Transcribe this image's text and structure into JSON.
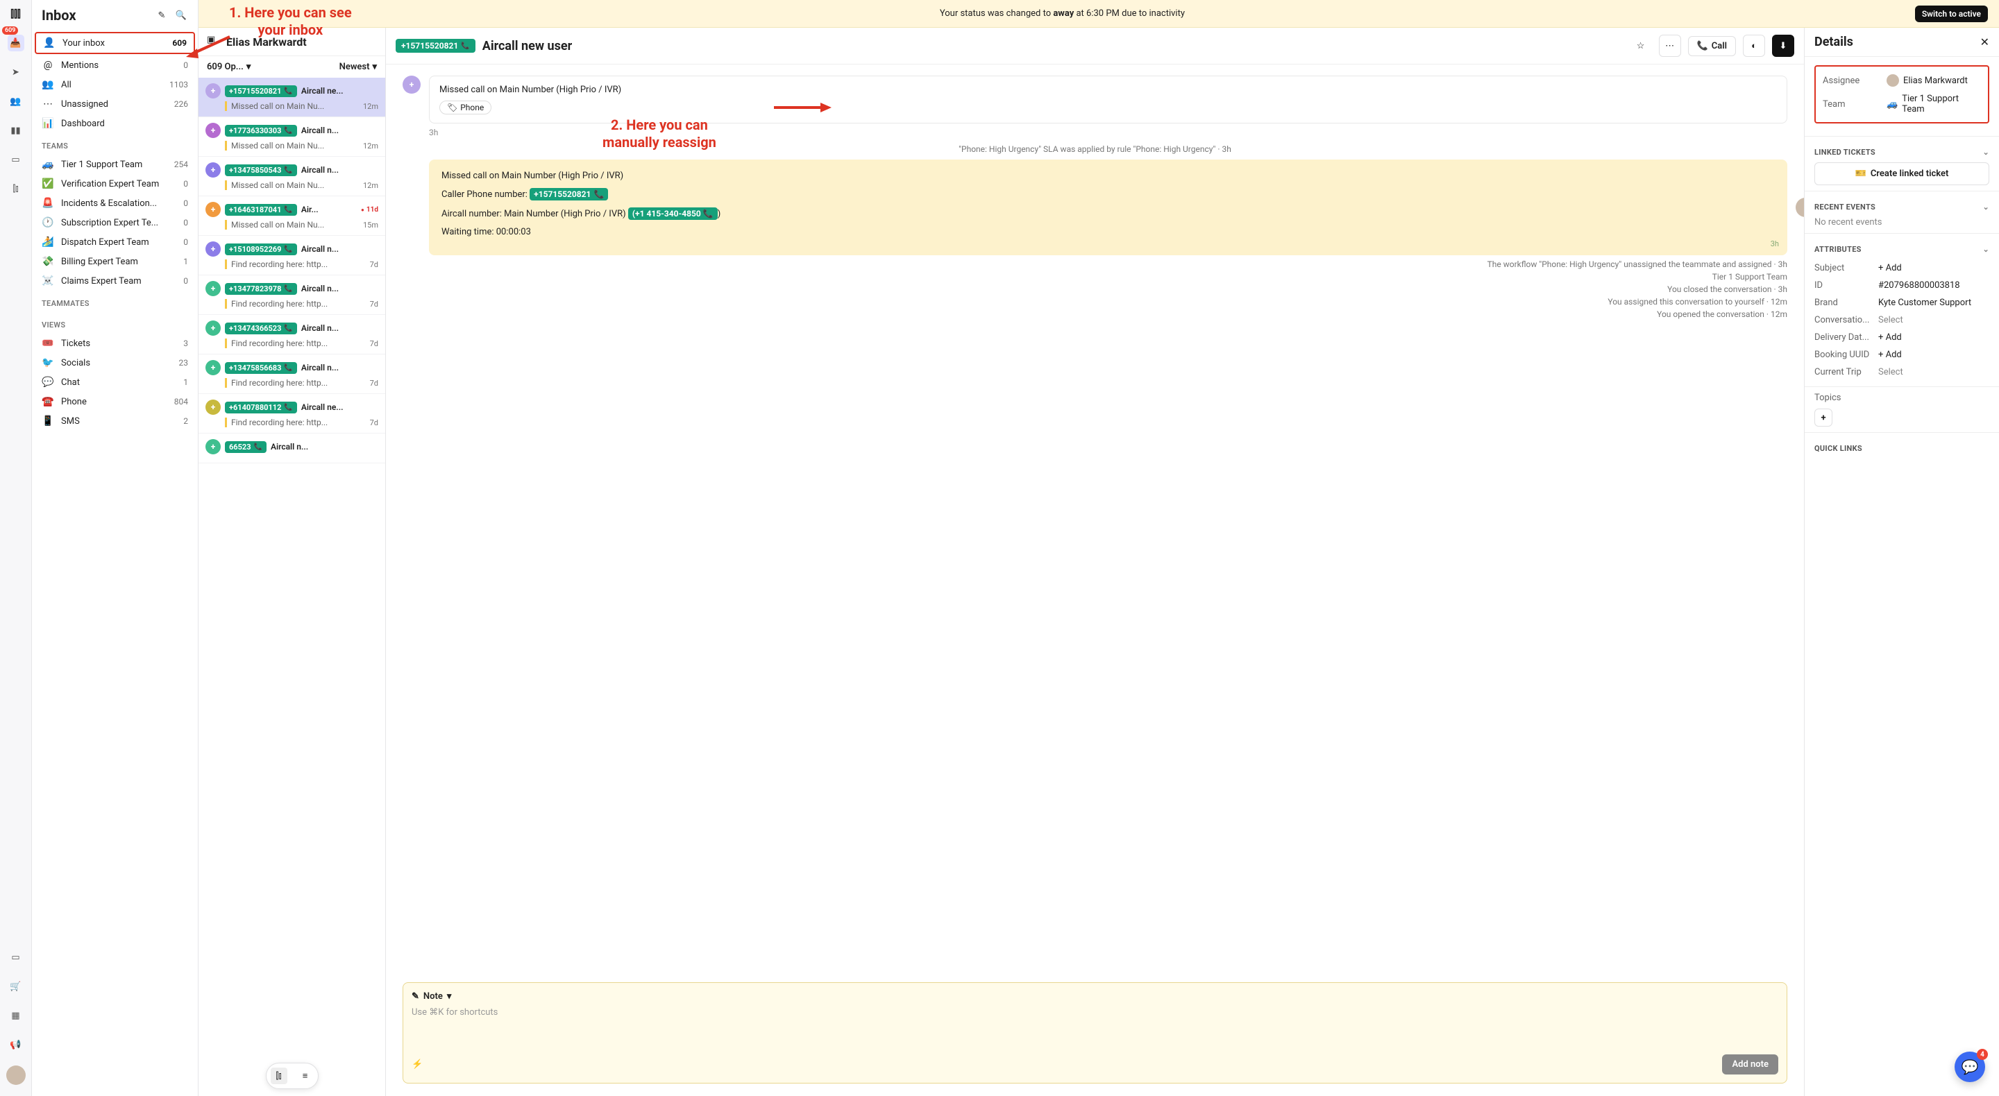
{
  "banner": {
    "text_prefix": "Your status was changed to ",
    "status_word": "away",
    "text_mid": " at 6:30 PM due to inactivity",
    "button": "Switch to active"
  },
  "rail": {
    "badge": "609"
  },
  "sidebar": {
    "title": "Inbox",
    "main": [
      {
        "icon": "👤",
        "label": "Your inbox",
        "count": "609",
        "boxed": true
      },
      {
        "icon": "@",
        "label": "Mentions",
        "count": "0"
      },
      {
        "icon": "👥",
        "label": "All",
        "count": "1103"
      },
      {
        "icon": "⋯",
        "label": "Unassigned",
        "count": "226"
      },
      {
        "icon": "📊",
        "label": "Dashboard",
        "count": ""
      }
    ],
    "teams_header": "TEAMS",
    "teams": [
      {
        "icon": "🚙",
        "label": "Tier 1 Support Team",
        "count": "254"
      },
      {
        "icon": "✅",
        "label": "Verification Expert Team",
        "count": "0"
      },
      {
        "icon": "🚨",
        "label": "Incidents & Escalation...",
        "count": "0"
      },
      {
        "icon": "🕐",
        "label": "Subscription Expert Te...",
        "count": "0"
      },
      {
        "icon": "🏄",
        "label": "Dispatch Expert Team",
        "count": "0"
      },
      {
        "icon": "💸",
        "label": "Billing Expert Team",
        "count": "1"
      },
      {
        "icon": "☠️",
        "label": "Claims Expert Team",
        "count": "0"
      }
    ],
    "teammates_header": "TEAMMATES",
    "views_header": "VIEWS",
    "views": [
      {
        "icon": "🎟️",
        "label": "Tickets",
        "count": "3"
      },
      {
        "icon": "🐦",
        "label": "Socials",
        "count": "23"
      },
      {
        "icon": "💬",
        "label": "Chat",
        "count": "1"
      },
      {
        "icon": "☎️",
        "label": "Phone",
        "count": "804"
      },
      {
        "icon": "📱",
        "label": "SMS",
        "count": "2"
      }
    ]
  },
  "convlist": {
    "header": "Elias Markwardt",
    "open_count": "609 Op...",
    "sort": "Newest",
    "items": [
      {
        "color": "#b9a6e8",
        "avatar": "+",
        "phone": "+15715520821",
        "subj": "Aircall ne...",
        "preview": "Missed call on Main Nu...",
        "time": "12m",
        "selected": true
      },
      {
        "color": "#b56bd0",
        "avatar": "+",
        "phone": "+17736330303",
        "subj": "Aircall n...",
        "preview": "Missed call on Main Nu...",
        "time": "12m"
      },
      {
        "color": "#8c7de8",
        "avatar": "+",
        "phone": "+13475850543",
        "subj": "Aircall n...",
        "preview": "Missed call on Main Nu...",
        "time": "12m"
      },
      {
        "color": "#f19a3e",
        "avatar": "+",
        "phone": "+16463187041",
        "subj": "Air...",
        "preview": "Missed call on Main Nu...",
        "time": "15m",
        "badge": "11d"
      },
      {
        "color": "#8c7de8",
        "avatar": "+",
        "phone": "+15108952269",
        "subj": "Aircall n...",
        "preview": "Find recording here: http...",
        "time": "7d"
      },
      {
        "color": "#3fbf8f",
        "avatar": "+",
        "phone": "+13477823978",
        "subj": "Aircall n...",
        "preview": "Find recording here: http...",
        "time": "7d"
      },
      {
        "color": "#3fbf8f",
        "avatar": "+",
        "phone": "+13474366523",
        "subj": "Aircall n...",
        "preview": "Find recording here: http...",
        "time": "7d"
      },
      {
        "color": "#3fbf8f",
        "avatar": "+",
        "phone": "+13475856683",
        "subj": "Aircall n...",
        "preview": "Find recording here: http...",
        "time": "7d"
      },
      {
        "color": "#c8b93d",
        "avatar": "+",
        "phone": "+61407880112",
        "subj": "Aircall ne...",
        "preview": "Find recording here: http...",
        "time": "7d"
      },
      {
        "color": "#3fbf8f",
        "avatar": "+",
        "phone": "66523",
        "subj": "Aircall n...",
        "preview": "",
        "time": ""
      }
    ]
  },
  "conv": {
    "phone": "+15715520821",
    "title": "Aircall new user",
    "call_label": "Call",
    "msg_title": "Missed call on Main Number (High Prio / IVR)",
    "msg_tag": "Phone",
    "msg_time": "3h",
    "sla_line": "\"Phone: High Urgency\" SLA was applied by rule \"Phone: High Urgency\" · 3h",
    "note": {
      "l1": "Missed call on Main Number (High Prio / IVR)",
      "l2_pre": "Caller Phone number: ",
      "l2_tag": "+15715520821",
      "l3_pre": "Aircall number: Main Number (High Prio / IVR) ",
      "l3_tag": "(+1 415-340-4850 📞",
      "l3_post": ")",
      "l4": "Waiting time: 00:00:03",
      "time": "3h"
    },
    "sys": [
      "The workflow \"Phone: High Urgency\" unassigned the teammate and assigned · 3h",
      "Tier 1 Support Team",
      "You closed the conversation · 3h",
      "You assigned this conversation to yourself · 12m",
      "You opened the conversation · 12m"
    ],
    "composer": {
      "mode": "Note",
      "placeholder": "Use ⌘K for shortcuts",
      "button": "Add note"
    }
  },
  "details": {
    "title": "Details",
    "assignee_label": "Assignee",
    "assignee_value": "Elias Markwardt",
    "team_label": "Team",
    "team_value": "Tier 1 Support Team",
    "linked_header": "LINKED TICKETS",
    "linked_button": "Create linked ticket",
    "recent_header": "RECENT EVENTS",
    "recent_empty": "No recent events",
    "attr_header": "ATTRIBUTES",
    "attrs": [
      {
        "label": "Subject",
        "value": "+ Add",
        "sel": false
      },
      {
        "label": "ID",
        "value": "#207968800003818"
      },
      {
        "label": "Brand",
        "value": "Kyte Customer Support"
      },
      {
        "label": "Conversatio...",
        "value": "Select",
        "sel": true
      },
      {
        "label": "Delivery Dat...",
        "value": "+ Add"
      },
      {
        "label": "Booking UUID",
        "value": "+ Add"
      },
      {
        "label": "Current Trip",
        "value": "Select",
        "sel": true
      }
    ],
    "topics_label": "Topics",
    "quicklinks_header": "QUICK LINKS"
  },
  "annotations": {
    "a1_l1": "1. Here you can see",
    "a1_l2": "your inbox",
    "a2_l1": "2. Here you can",
    "a2_l2": "manually reassign"
  },
  "chat_badge": "4"
}
